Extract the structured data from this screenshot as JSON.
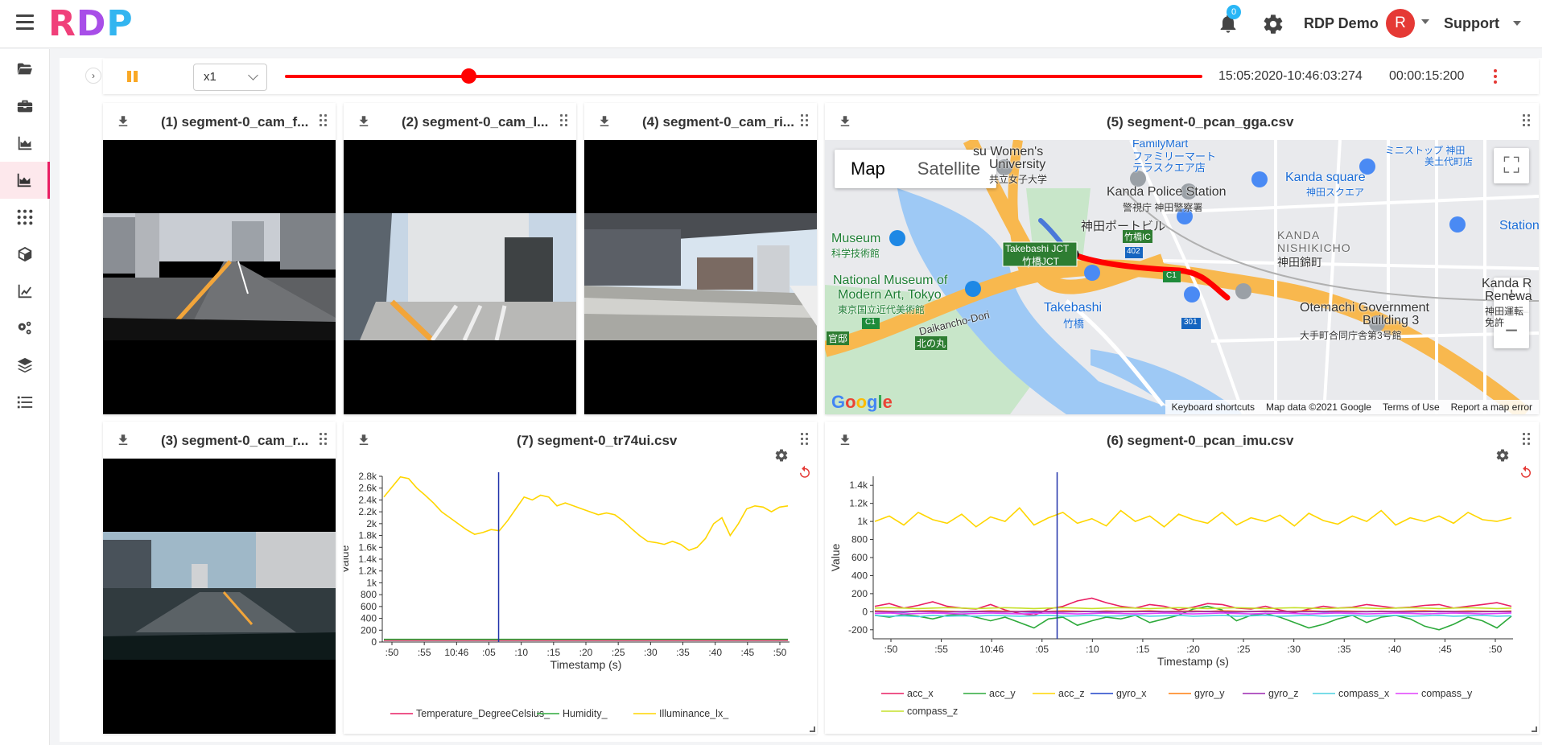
{
  "app": {
    "logo": [
      "R",
      "D",
      "P"
    ],
    "notifications_count": "0",
    "user_name": "RDP Demo",
    "avatar_letter": "R",
    "support_label": "Support"
  },
  "sidebar": {
    "items": [
      {
        "name": "folder-open-icon",
        "active": false
      },
      {
        "name": "toolbox-icon",
        "active": false
      },
      {
        "name": "area-chart-icon",
        "active": false
      },
      {
        "name": "area-chart-active-icon",
        "active": true
      },
      {
        "name": "grid-dots-icon",
        "active": false
      },
      {
        "name": "cube-icon",
        "active": false
      },
      {
        "name": "line-chart-icon",
        "active": false
      },
      {
        "name": "cogs-icon",
        "active": false
      },
      {
        "name": "layers-icon",
        "active": false
      },
      {
        "name": "list-icon",
        "active": false
      }
    ]
  },
  "playback": {
    "speed": "x1",
    "progress": 0.2,
    "timestamp": "15:05:2020-10:46:03:274",
    "duration": "00:00:15:200",
    "colors": {
      "track": "#ff0000",
      "pause": "#f9a825"
    }
  },
  "cards": {
    "cam1": {
      "title": "(1) segment-0_cam_f..."
    },
    "cam2": {
      "title": "(2) segment-0_cam_l..."
    },
    "cam4": {
      "title": "(4) segment-0_cam_ri..."
    },
    "cam3": {
      "title": "(3) segment-0_cam_r..."
    },
    "gga": {
      "title": "(5) segment-0_pcan_gga.csv"
    },
    "tr74": {
      "title": "(7) segment-0_tr74ui.csv"
    },
    "imu": {
      "title": "(6) segment-0_pcan_imu.csv"
    }
  },
  "map": {
    "type_buttons": [
      "Map",
      "Satellite"
    ],
    "zoom_in": "+",
    "zoom_out": "−",
    "labels": {
      "womens_univ": "su Women's",
      "university": "University",
      "kyoritsu": "共立女子大学",
      "familymart": "FamilyMart",
      "familymart_jp": "ファミリーマート",
      "terrace": "テラスクエア店",
      "kanda_police": "Kanda Police Station",
      "kanda_police_jp": "警視庁 神田警察署",
      "kanda_porte": "神田ポートビル",
      "kanda_square": "Kanda square",
      "kanda_square_jp": "神田スクエア",
      "mini_stop": "ミニストップ 神田",
      "mini_stop_2": "美土代町店",
      "museum": "Museum",
      "museum_jp": "科学技術館",
      "takebashi_jct": "Takebashi JCT",
      "takebashi_jct_jp": "竹橋JCT",
      "jct_ic": "竹橋IC",
      "route_402": "402",
      "kanda_nishikicho": "KANDA",
      "nishikicho": "NISHIKICHO",
      "nishikicho_jp": "神田錦町",
      "station": "Station",
      "national_museum": "National Museum of",
      "modern_art": "Modern Art, Tokyo",
      "modern_art_jp": "東京国立近代美術館",
      "route_c1": "C1",
      "daikancho": "Daikancho-Dori",
      "takebashi": "Takebashi",
      "takebashi_jp": "竹橋",
      "route_301": "301",
      "otemachi": "Otemachi Government",
      "building": "Building 3",
      "otemachi_jp": "大手町合同庁舎第3号館",
      "kanda_r": "Kanda R",
      "renew": "Renewa",
      "kanda_jp": "神田運転",
      "kanda_jp2": "免許",
      "kannon": "官邸",
      "kitanomaru": "北の丸",
      "c1_left": "C1"
    },
    "footer": [
      "Keyboard shortcuts",
      "Map data ©2021 Google",
      "Terms of Use",
      "Report a map error"
    ],
    "google": [
      "G",
      "o",
      "o",
      "g",
      "l",
      "e"
    ]
  },
  "chart_data": [
    {
      "type": "line",
      "title": "(7) segment-0_tr74ui.csv",
      "xlabel": "Timestamp (s)",
      "ylabel": "Value",
      "x_ticks": [
        ":50",
        ":55",
        "10:46",
        ":05",
        ":10",
        ":15",
        ":20",
        ":25",
        ":30",
        ":35",
        ":40",
        ":45",
        ":50"
      ],
      "y_ticks": [
        "2.8k",
        "2.6k",
        "2.4k",
        "2.2k",
        "2k",
        "1.8k",
        "1.6k",
        "1.4k",
        "1.2k",
        "1k",
        "800",
        "600",
        "400",
        "200",
        "0"
      ],
      "ylim": [
        0,
        2800
      ],
      "cursor_index": 3.3,
      "legend_position": "bottom",
      "series": [
        {
          "name": "Temperature_DegreeCelsius_",
          "color": "#e91e63",
          "values": [
            30,
            30,
            30,
            30,
            30,
            30,
            30,
            30,
            30,
            30,
            30,
            30,
            30,
            30,
            30,
            30,
            30,
            30,
            30,
            30,
            30,
            30,
            30,
            30,
            30,
            30,
            30,
            30,
            30,
            30,
            30,
            30,
            30,
            30,
            30,
            30,
            30,
            30,
            30,
            30,
            30,
            30,
            30,
            30,
            30,
            30,
            30,
            30,
            30,
            30,
            30,
            30,
            30
          ]
        },
        {
          "name": "Humidity_",
          "color": "#2eaa3c",
          "values": [
            45,
            45,
            45,
            45,
            45,
            45,
            45,
            45,
            45,
            45,
            45,
            45,
            45,
            45,
            45,
            45,
            45,
            45,
            45,
            45,
            45,
            45,
            45,
            45,
            45,
            45,
            45,
            45,
            45,
            45,
            45,
            45,
            45,
            45,
            45,
            45,
            45,
            45,
            45,
            45,
            45,
            45,
            45,
            45,
            45,
            45,
            45,
            45,
            45,
            45,
            45,
            45,
            45
          ]
        },
        {
          "name": "Illuminance_lx_",
          "color": "#ffd600",
          "values": [
            2450,
            2620,
            2790,
            2760,
            2600,
            2480,
            2350,
            2200,
            2100,
            2000,
            1900,
            1820,
            1850,
            1900,
            1880,
            2050,
            2250,
            2450,
            2400,
            2480,
            2450,
            2300,
            2350,
            2300,
            2250,
            2200,
            2150,
            2180,
            2150,
            2050,
            1920,
            1800,
            1700,
            1680,
            1650,
            1700,
            1650,
            1550,
            1600,
            1750,
            2000,
            2100,
            1800,
            2000,
            2250,
            2300,
            2280,
            2200,
            2280,
            2300
          ]
        }
      ]
    },
    {
      "type": "line",
      "title": "(6) segment-0_pcan_imu.csv",
      "xlabel": "Timestamp (s)",
      "ylabel": "Value",
      "x_ticks": [
        ":50",
        ":55",
        "10:46",
        ":05",
        ":10",
        ":15",
        ":20",
        ":25",
        ":30",
        ":35",
        ":40",
        ":45",
        ":50"
      ],
      "y_ticks": [
        "1.4k",
        "1.2k",
        "1k",
        "800",
        "600",
        "400",
        "200",
        "0",
        "-200"
      ],
      "ylim": [
        -300,
        1500
      ],
      "cursor_index": 3.3,
      "legend_position": "bottom",
      "series": [
        {
          "name": "acc_x",
          "color": "#e91e63",
          "values": [
            60,
            90,
            40,
            70,
            110,
            60,
            40,
            30,
            80,
            20,
            -20,
            -40,
            30,
            60,
            120,
            150,
            100,
            60,
            40,
            80,
            60,
            20,
            50,
            90,
            80,
            40,
            30,
            60,
            20,
            -10,
            30,
            60,
            40,
            50,
            80,
            60,
            40,
            50,
            70,
            80,
            40,
            60,
            80,
            100,
            60
          ]
        },
        {
          "name": "acc_y",
          "color": "#2eaa3c",
          "values": [
            -40,
            -60,
            -30,
            -50,
            -80,
            -40,
            -30,
            -60,
            -100,
            -60,
            -120,
            -180,
            -80,
            -60,
            -150,
            -100,
            -60,
            -80,
            -40,
            -120,
            -80,
            -40,
            30,
            60,
            20,
            -100,
            -40,
            -20,
            -60,
            -120,
            -180,
            -140,
            -80,
            -40,
            -120,
            -60,
            -40,
            -80,
            -160,
            -200,
            -140,
            -60,
            -100,
            -180,
            -50
          ]
        },
        {
          "name": "acc_z",
          "color": "#ffd600",
          "values": [
            1000,
            1060,
            960,
            1100,
            1020,
            980,
            1080,
            940,
            1050,
            1000,
            1150,
            960,
            1040,
            1100,
            980,
            1030,
            950,
            1120,
            1000,
            1060,
            940,
            1080,
            1020,
            980,
            1100,
            960,
            1040,
            1000,
            1070,
            950,
            1090,
            1010,
            970,
            1060,
            1000,
            1120,
            960,
            1040,
            1000,
            1060,
            980,
            1100,
            1020,
            1000,
            1040
          ]
        },
        {
          "name": "gyro_x",
          "color": "#1e44c8",
          "values": [
            5,
            0,
            -5,
            8,
            0,
            5,
            -3,
            0,
            6,
            2,
            0,
            -4,
            3,
            0,
            5,
            0,
            -2,
            4,
            0,
            3,
            -1,
            2,
            0,
            5,
            0,
            -3,
            2,
            0,
            4,
            0,
            2,
            -2,
            0,
            3,
            0,
            2,
            0,
            -1,
            3,
            0,
            2,
            0,
            1,
            3,
            0
          ]
        },
        {
          "name": "gyro_y",
          "color": "#ff7f0e",
          "values": [
            10,
            5,
            0,
            8,
            12,
            6,
            0,
            4,
            10,
            6,
            2,
            8,
            4,
            10,
            6,
            0,
            8,
            4,
            6,
            10,
            2,
            6,
            8,
            4,
            10,
            6,
            2,
            8,
            4,
            6,
            10,
            4,
            8,
            6,
            2,
            6,
            4,
            8,
            10,
            6,
            4,
            8,
            6,
            4,
            8
          ]
        },
        {
          "name": "gyro_z",
          "color": "#9c27b0",
          "values": [
            0,
            -2,
            0,
            2,
            0,
            -3,
            0,
            2,
            0,
            -2,
            0,
            3,
            0,
            -2,
            0,
            2,
            0,
            -1,
            0,
            2,
            0,
            -2,
            0,
            1,
            0,
            -2,
            0,
            2,
            0,
            -1,
            0,
            2,
            0,
            -2,
            0,
            1,
            0,
            -1,
            0,
            2,
            0,
            -2,
            0,
            1,
            0
          ]
        },
        {
          "name": "compass_x",
          "color": "#4dd0e1",
          "values": [
            -40,
            -50,
            -45,
            -55,
            -40,
            -50,
            -45,
            -50,
            -40,
            -45,
            -50,
            -45,
            -40,
            -50,
            -45,
            -40,
            -50,
            -45,
            -40,
            -50,
            -45,
            -40,
            -50,
            -45,
            -40,
            -50,
            -45,
            -40,
            -50,
            -45,
            -40,
            -50,
            -45,
            -40,
            -50,
            -45,
            -40,
            -50,
            -45,
            -40,
            -50,
            -45,
            -40,
            -50,
            -45
          ]
        },
        {
          "name": "compass_y",
          "color": "#e040fb",
          "values": [
            -20,
            -15,
            -25,
            -20,
            -15,
            -20,
            -25,
            -20,
            -15,
            -20,
            -25,
            -20,
            -15,
            -20,
            -25,
            -20,
            -15,
            -20,
            -25,
            -20,
            -15,
            -20,
            -25,
            -20,
            -15,
            -20,
            -25,
            -20,
            -15,
            -20,
            -25,
            -20,
            -15,
            -20,
            -25,
            -20,
            -15,
            -20,
            -25,
            -20,
            -15,
            -20,
            -25,
            -20,
            -15
          ]
        },
        {
          "name": "compass_z",
          "color": "#c6e02b",
          "values": [
            40,
            45,
            40,
            35,
            40,
            45,
            40,
            35,
            40,
            45,
            40,
            35,
            40,
            45,
            40,
            35,
            40,
            45,
            40,
            35,
            40,
            45,
            40,
            35,
            40,
            45,
            40,
            35,
            40,
            45,
            40,
            35,
            40,
            45,
            40,
            35,
            40,
            45,
            40,
            35,
            40,
            45,
            40,
            35,
            40
          ]
        }
      ]
    }
  ]
}
